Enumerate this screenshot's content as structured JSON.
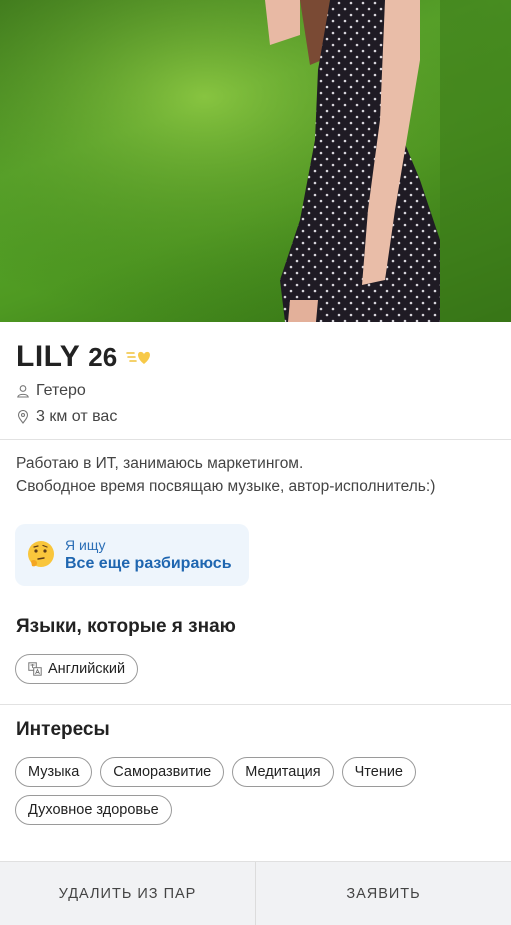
{
  "profile": {
    "name": "LILY",
    "age": "26",
    "orientation": "Гетеро",
    "distance": "3 км от вас",
    "about_lines": [
      "Работаю в ИТ, занимаюсь маркетингом.",
      "Свободное время посвящаю музыке, автор-исполнитель:)"
    ],
    "seeking": {
      "label": "Я ищу",
      "value": "Все еще разбираюсь",
      "emoji": "thinking-face-icon"
    }
  },
  "languages": {
    "title": "Языки, которые я знаю",
    "items": [
      "Английский"
    ],
    "icon": "translate-icon"
  },
  "interests": {
    "title": "Интересы",
    "items": [
      "Музыка",
      "Саморазвитие",
      "Медитация",
      "Чтение",
      "Духовное здоровье"
    ]
  },
  "actions": {
    "remove_label": "УДАЛИТЬ ИЗ ПАР",
    "report_label": "ЗАЯВИТЬ"
  },
  "colors": {
    "accent_blue": "#1f66b0",
    "seeking_bg": "#eef5fc",
    "bottom_bar_bg": "#f1f2f4"
  }
}
